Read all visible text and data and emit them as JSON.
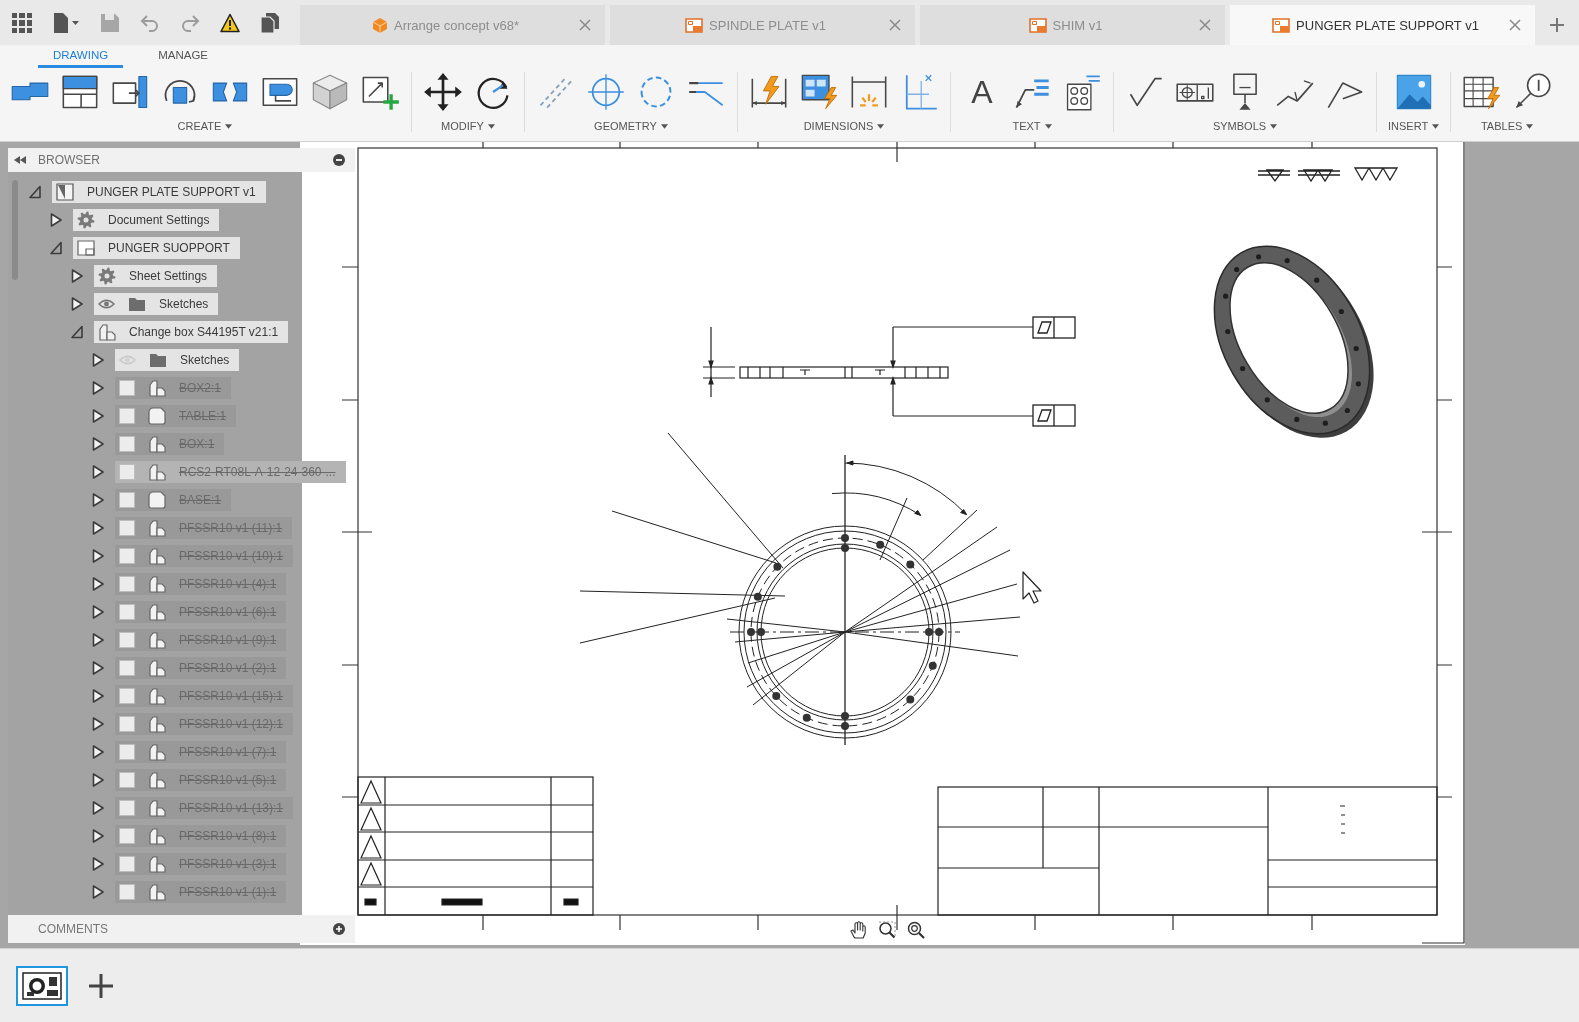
{
  "document_tabs": [
    {
      "label": "Arrange concept v68*",
      "kind": "design",
      "selected": false
    },
    {
      "label": "SPINDLE PLATE v1",
      "kind": "drawing",
      "selected": false
    },
    {
      "label": "SHIM v1",
      "kind": "drawing",
      "selected": false
    },
    {
      "label": "PUNGER PLATE SUPPORT v1",
      "kind": "drawing",
      "selected": true
    }
  ],
  "ribbon": {
    "tabs": [
      {
        "label": "DRAWING",
        "selected": true
      },
      {
        "label": "MANAGE",
        "selected": false
      }
    ],
    "groups": [
      {
        "label": "CREATE",
        "kind": "views"
      },
      {
        "label": "MODIFY",
        "kind": "modify"
      },
      {
        "label": "GEOMETRY",
        "kind": "geometry"
      },
      {
        "label": "DIMENSIONS",
        "kind": "dimensions"
      },
      {
        "label": "TEXT",
        "kind": "text",
        "glyph": "A"
      },
      {
        "label": "SYMBOLS",
        "kind": "symbols"
      },
      {
        "label": "INSERT",
        "kind": "insert"
      },
      {
        "label": "TABLES",
        "kind": "tables"
      }
    ]
  },
  "browser": {
    "title": "BROWSER",
    "tree": [
      {
        "label": "PUNGER PLATE SUPPORT v1",
        "kind": "drawing",
        "expanded": true,
        "excluded": false,
        "highlighted": false,
        "children": [
          {
            "label": "Document Settings",
            "kind": "settings",
            "expanded": false,
            "excluded": false,
            "highlighted": false
          },
          {
            "label": "PUNGER SUOPPORT",
            "kind": "sheet",
            "expanded": true,
            "excluded": false,
            "highlighted": false,
            "children": [
              {
                "label": "Sheet Settings",
                "kind": "settings",
                "expanded": false,
                "excluded": false,
                "highlighted": false
              },
              {
                "label": "Sketches",
                "kind": "folder",
                "visible": true,
                "expanded": false,
                "excluded": false,
                "highlighted": false
              },
              {
                "label": "Change box S44195T v21:1",
                "kind": "component",
                "expanded": true,
                "excluded": false,
                "highlighted": false,
                "children": [
                  {
                    "label": "Sketches",
                    "kind": "folder",
                    "visible": false,
                    "expanded": false,
                    "excluded": false,
                    "highlighted": false
                  },
                  {
                    "label": "BOX2:1",
                    "kind": "component",
                    "visible": false,
                    "expanded": false,
                    "excluded": true,
                    "highlighted": false
                  },
                  {
                    "label": "TABLE:1",
                    "kind": "body",
                    "visible": false,
                    "expanded": false,
                    "excluded": true,
                    "highlighted": false
                  },
                  {
                    "label": "BOX:1",
                    "kind": "component",
                    "visible": false,
                    "expanded": false,
                    "excluded": true,
                    "highlighted": false
                  },
                  {
                    "label": "RCS2-RT08L-A-12-24-360-...",
                    "kind": "component",
                    "visible": false,
                    "expanded": false,
                    "excluded": true,
                    "highlighted": true
                  },
                  {
                    "label": "BASE:1",
                    "kind": "body",
                    "visible": false,
                    "expanded": false,
                    "excluded": true,
                    "highlighted": false
                  },
                  {
                    "label": "PFSSR10 v1 (11):1",
                    "kind": "component",
                    "visible": false,
                    "expanded": false,
                    "excluded": true,
                    "highlighted": false
                  },
                  {
                    "label": "PFSSR10 v1 (10):1",
                    "kind": "component",
                    "visible": false,
                    "expanded": false,
                    "excluded": true,
                    "highlighted": false
                  },
                  {
                    "label": "PFSSR10 v1 (4):1",
                    "kind": "component",
                    "visible": false,
                    "expanded": false,
                    "excluded": true,
                    "highlighted": false
                  },
                  {
                    "label": "PFSSR10 v1 (6):1",
                    "kind": "component",
                    "visible": false,
                    "expanded": false,
                    "excluded": true,
                    "highlighted": false
                  },
                  {
                    "label": "PFSSR10 v1 (9):1",
                    "kind": "component",
                    "visible": false,
                    "expanded": false,
                    "excluded": true,
                    "highlighted": false
                  },
                  {
                    "label": "PFSSR10 v1 (2):1",
                    "kind": "component",
                    "visible": false,
                    "expanded": false,
                    "excluded": true,
                    "highlighted": false
                  },
                  {
                    "label": "PFSSR10 v1 (15):1",
                    "kind": "component",
                    "visible": false,
                    "expanded": false,
                    "excluded": true,
                    "highlighted": false
                  },
                  {
                    "label": "PFSSR10 v1 (12):1",
                    "kind": "component",
                    "visible": false,
                    "expanded": false,
                    "excluded": true,
                    "highlighted": false
                  },
                  {
                    "label": "PFSSR10 v1 (7):1",
                    "kind": "component",
                    "visible": false,
                    "expanded": false,
                    "excluded": true,
                    "highlighted": false
                  },
                  {
                    "label": "PFSSR10 v1 (5):1",
                    "kind": "component",
                    "visible": false,
                    "expanded": false,
                    "excluded": true,
                    "highlighted": false
                  },
                  {
                    "label": "PFSSR10 v1 (13):1",
                    "kind": "component",
                    "visible": false,
                    "expanded": false,
                    "excluded": true,
                    "highlighted": false
                  },
                  {
                    "label": "PFSSR10 v1 (8):1",
                    "kind": "component",
                    "visible": false,
                    "expanded": false,
                    "excluded": true,
                    "highlighted": false
                  },
                  {
                    "label": "PFSSR10 v1 (3):1",
                    "kind": "component",
                    "visible": false,
                    "expanded": false,
                    "excluded": true,
                    "highlighted": false
                  },
                  {
                    "label": "PFSSR10 v1 (1):1",
                    "kind": "component",
                    "visible": false,
                    "expanded": false,
                    "excluded": true,
                    "highlighted": false
                  }
                ]
              }
            ]
          }
        ]
      }
    ]
  },
  "comments": {
    "title": "COMMENTS"
  },
  "sheets": [
    {
      "selected": true
    }
  ]
}
